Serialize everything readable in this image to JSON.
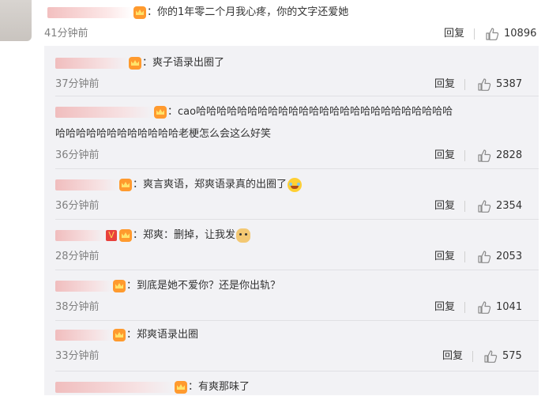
{
  "top_comment": {
    "text": "：你的1年零二个月我心疼，你的文字还爱她",
    "time": "41分钟前",
    "reply_label": "回复",
    "likes": "10896"
  },
  "replies": [
    {
      "text": "：爽子语录出圈了",
      "time": "37分钟前",
      "reply_label": "回复",
      "likes": "5387"
    },
    {
      "text_line1": "：cao哈哈哈哈哈哈哈哈哈哈哈哈哈哈哈哈哈哈哈哈哈哈哈哈哈",
      "text_line2": "哈哈哈哈哈哈哈哈哈哈哈哈老梗怎么会这么好笑",
      "time": "36分钟前",
      "reply_label": "回复",
      "likes": "2828"
    },
    {
      "text": "：爽言爽语，郑爽语录真的出圈了",
      "emoji": "laugh-cry-icon",
      "time": "36分钟前",
      "reply_label": "回复",
      "likes": "2354"
    },
    {
      "text": "：郑爽：删掉，让我发",
      "emoji": "doge-icon",
      "time": "28分钟前",
      "reply_label": "回复",
      "likes": "2053"
    },
    {
      "text": "：到底是她不爱你？还是你出轨？",
      "time": "38分钟前",
      "reply_label": "回复",
      "likes": "1041"
    },
    {
      "text": "：郑爽语录出圈",
      "time": "33分钟前",
      "reply_label": "回复",
      "likes": "575"
    },
    {
      "text": "：有爽那味了"
    }
  ],
  "colors": {
    "panel_bg": "#f2f2f5",
    "time_gray": "#808080",
    "text": "#333333"
  }
}
